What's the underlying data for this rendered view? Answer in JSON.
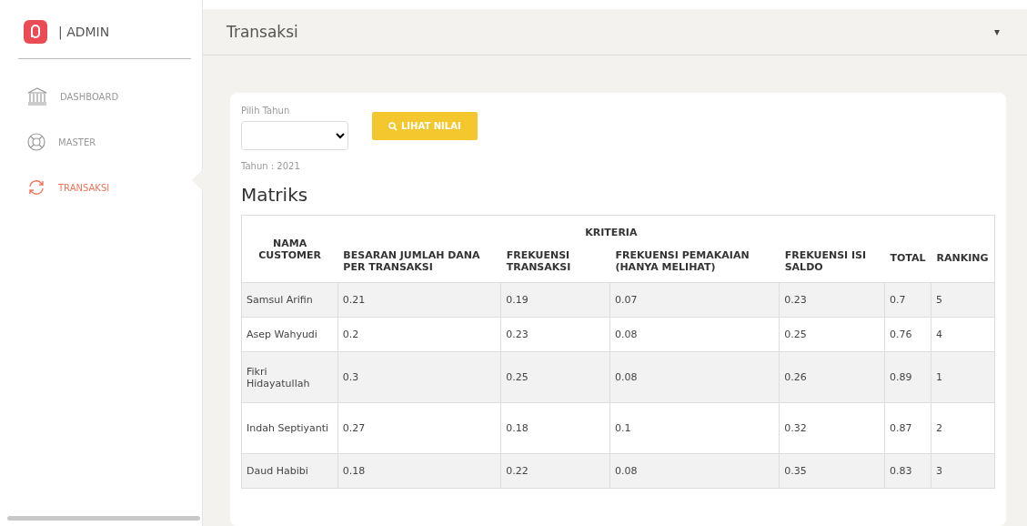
{
  "brand": {
    "title": "| ADMIN"
  },
  "sidebar": {
    "items": [
      {
        "label": "DASHBOARD",
        "selected": false
      },
      {
        "label": "MASTER",
        "selected": false
      },
      {
        "label": "TRANSAKSI",
        "selected": true
      }
    ]
  },
  "header": {
    "title": "Transaksi",
    "menu_caret": "▾"
  },
  "filter": {
    "label": "Pilih Tahun",
    "button": "LIHAT NILAI",
    "year_note": "Tahun : 2021"
  },
  "matrix": {
    "title": "Matriks",
    "group_heading": "KRITERIA",
    "columns": [
      "NAMA CUSTOMER",
      "BESARAN JUMLAH DANA PER TRANSAKSI",
      "FREKUENSI TRANSAKSI",
      "FREKUENSI PEMAKAIAN (HANYA MELIHAT)",
      "FREKUENSI ISI SALDO",
      "TOTAL",
      "RANKING"
    ],
    "rows": [
      [
        "Samsul Arifin",
        "0.21",
        "0.19",
        "0.07",
        "0.23",
        "0.7",
        "5"
      ],
      [
        "Asep Wahyudi",
        "0.2",
        "0.23",
        "0.08",
        "0.25",
        "0.76",
        "4"
      ],
      [
        "Fikri Hidayatullah",
        "0.3",
        "0.25",
        "0.08",
        "0.26",
        "0.89",
        "1"
      ],
      [
        "Indah Septiyanti",
        "0.27",
        "0.18",
        "0.1",
        "0.32",
        "0.87",
        "2"
      ],
      [
        "Daud Habibi",
        "0.18",
        "0.22",
        "0.08",
        "0.35",
        "0.83",
        "3"
      ]
    ]
  }
}
